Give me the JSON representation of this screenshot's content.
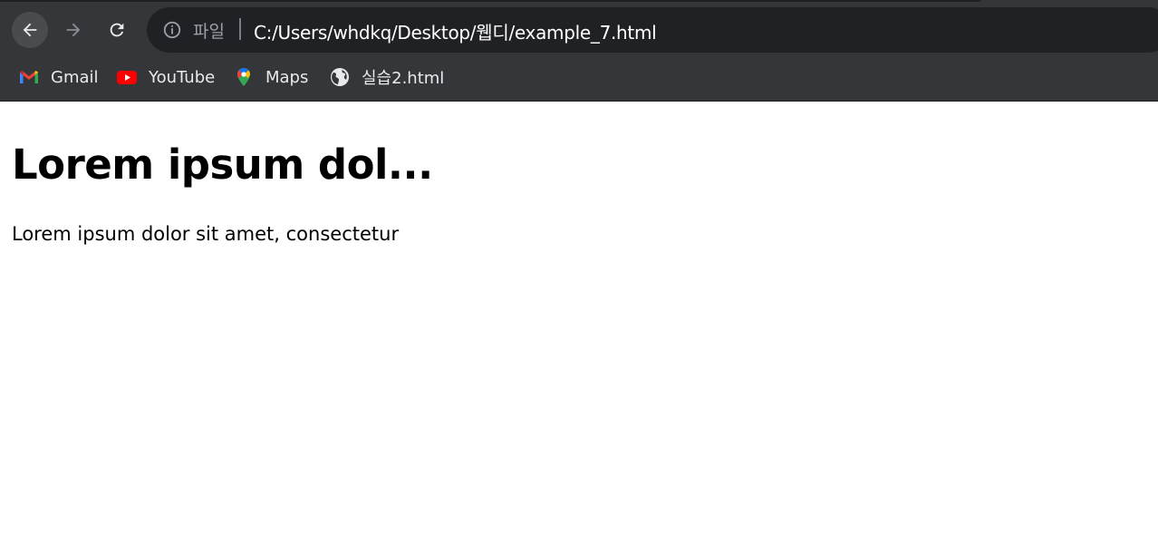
{
  "browser": {
    "nav": {
      "back_icon": "arrow-left-icon",
      "forward_icon": "arrow-right-icon",
      "reload_icon": "reload-icon"
    },
    "address_bar": {
      "info_icon": "info-icon",
      "scheme_label": "파일",
      "url": "C:/Users/whdkq/Desktop/웹디/example_7.html"
    },
    "bookmarks": [
      {
        "label": "Gmail",
        "icon": "gmail-icon"
      },
      {
        "label": "YouTube",
        "icon": "youtube-icon"
      },
      {
        "label": "Maps",
        "icon": "maps-icon"
      },
      {
        "label": "실습2.html",
        "icon": "globe-icon"
      }
    ],
    "colors": {
      "toolbar": "#35363a",
      "omnibox": "#202124"
    }
  },
  "page": {
    "heading": "Lorem ipsum dol...",
    "paragraph": "Lorem ipsum dolor sit amet, consectetur"
  }
}
